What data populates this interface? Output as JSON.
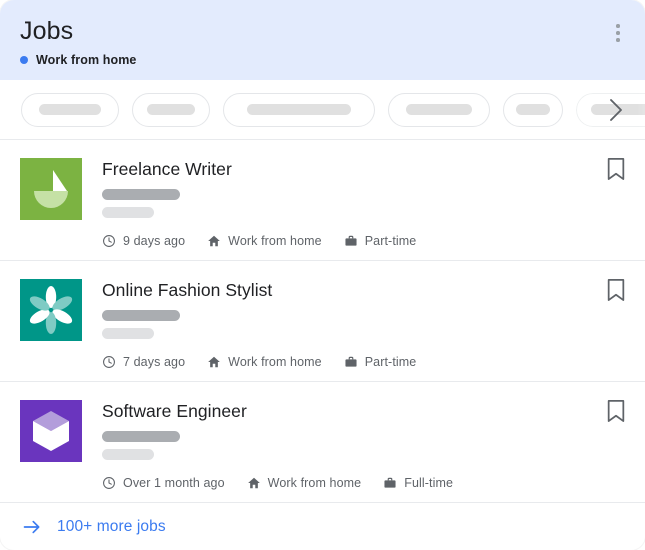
{
  "header": {
    "title": "Jobs",
    "subtitle": "Work from home",
    "dot_color": "#3b7bf0",
    "background": "#e3ebfd",
    "menu_icon": "kebab-menu-icon"
  },
  "filter_chips": {
    "placeholder_widths": [
      82,
      62,
      136,
      86,
      44,
      110
    ],
    "chip_widths": [
      98,
      78,
      152,
      102,
      60,
      126
    ],
    "next_icon": "chevron-right-icon"
  },
  "jobs": [
    {
      "title": "Freelance Writer",
      "logo": {
        "name": "sailboat-logo",
        "background": "#7cb342",
        "sail": "#ffffff",
        "hull": "#c5e1a5"
      },
      "posted": "9 days ago",
      "location": "Work from home",
      "job_type": "Part-time",
      "bookmark_icon": "bookmark-icon"
    },
    {
      "title": "Online Fashion Stylist",
      "logo": {
        "name": "flower-logo",
        "background": "#009688",
        "petal_light": "#ffffff",
        "petal_dark": "#7fcbc4"
      },
      "posted": "7 days ago",
      "location": "Work from home",
      "job_type": "Part-time",
      "bookmark_icon": "bookmark-icon"
    },
    {
      "title": "Software Engineer",
      "logo": {
        "name": "cube-logo",
        "background": "#6a35be",
        "top_face": "#b39ddb",
        "side_face": "#ffffff"
      },
      "posted": "Over 1 month ago",
      "location": "Work from home",
      "job_type": "Full-time",
      "bookmark_icon": "bookmark-icon"
    }
  ],
  "footer": {
    "label": "100+ more jobs",
    "icon": "arrow-right-icon",
    "color": "#3b7bf0"
  },
  "icons": {
    "clock": "clock-icon",
    "home": "home-icon",
    "briefcase": "briefcase-icon"
  }
}
